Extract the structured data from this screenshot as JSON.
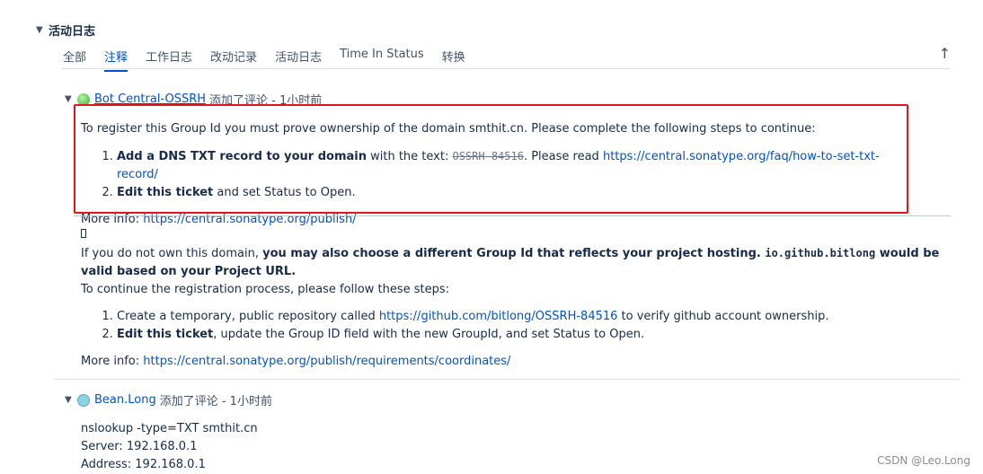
{
  "section": {
    "title": "活动日志"
  },
  "tabs": [
    {
      "label": "全部",
      "active": false
    },
    {
      "label": "注释",
      "active": true
    },
    {
      "label": "工作日志",
      "active": false
    },
    {
      "label": "改动记录",
      "active": false
    },
    {
      "label": "活动日志",
      "active": false
    },
    {
      "label": "Time In Status",
      "active": false
    },
    {
      "label": "转换",
      "active": false
    }
  ],
  "up_arrow": "↑",
  "comment1": {
    "author": "Bot Central-OSSRH",
    "meta": "添加了评论 - 1小时前",
    "intro": "To register this Group Id you must prove ownership of the domain smthit.cn. Please complete the following steps to continue:",
    "step1_bold": "Add a DNS TXT record to your domain",
    "step1_text": " with the text: ",
    "step1_code": "OSSRH-84516",
    "step1_after": ". Please read ",
    "step1_link": "https://central.sonatype.org/faq/how-to-set-txt-record/",
    "step2_bold": "Edit this ticket",
    "step2_text": " and set Status to Open.",
    "more_info_label": "More info: ",
    "more_info_link": "https://central.sonatype.org/publish/",
    "glyph": "",
    "p2_a": "If you do not own this domain, ",
    "p2_b": "you may also choose a different Group Id that reflects your project hosting. ",
    "p2_code": "io.github.bitlong",
    "p2_c": " would be valid based on your Project URL.",
    "p3": "To continue the registration process, please follow these steps:",
    "stepA_text": "Create a temporary, public repository called ",
    "stepA_link": "https://github.com/bitlong/OSSRH-84516",
    "stepA_after": " to verify github account ownership.",
    "stepB_bold": "Edit this ticket",
    "stepB_text": ", update the Group ID field with the new GroupId, and set Status to Open.",
    "more_info2_label": "More info: ",
    "more_info2_link": "https://central.sonatype.org/publish/requirements/coordinates/"
  },
  "comment2": {
    "author": "Bean.Long",
    "meta": "添加了评论 - 1小时前",
    "lines": [
      "nslookup -type=TXT smthit.cn",
      "Server: 192.168.0.1",
      "Address: 192.168.0.1"
    ]
  },
  "watermark": "CSDN @Leo.Long",
  "colors": {
    "link": "#0052cc",
    "highlight_border": "#e0161d",
    "text": "#172b4d"
  }
}
